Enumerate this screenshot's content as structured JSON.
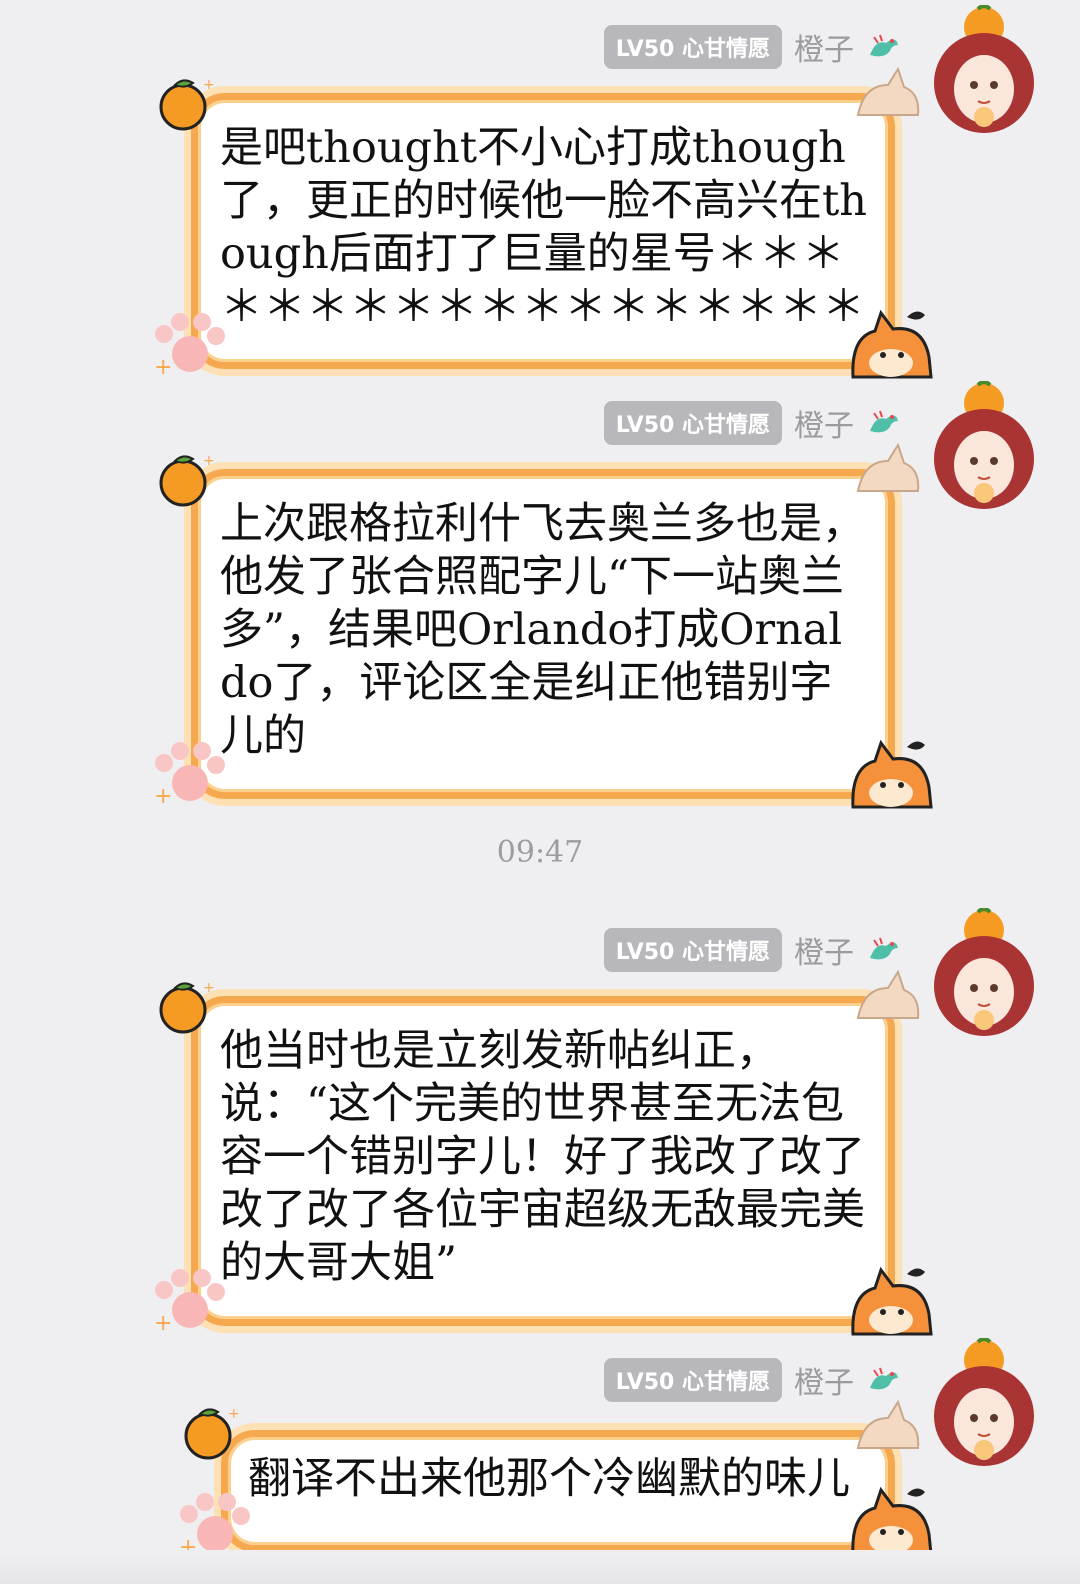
{
  "messages": [
    {
      "badge": "LV50 心甘情愿",
      "name": "橙子",
      "text": "是吧thought不小心打成though了，更正的时候他一脸不高兴在though后面打了巨量的星号＊＊＊＊＊＊＊＊＊＊＊＊＊＊＊＊＊＊"
    },
    {
      "badge": "LV50 心甘情愿",
      "name": "橙子",
      "text": "上次跟格拉利什飞去奥兰多也是，他发了张合照配字儿“下一站奥兰多”，结果吧Orlando打成Ornaldo了，评论区全是纠正他错别字儿的"
    },
    {
      "badge": "LV50 心甘情愿",
      "name": "橙子",
      "text": "他当时也是立刻发新帖纠正，说：“这个完美的世界甚至无法包容一个错别字儿！好了我改了改了改了改了各位宇宙超级无敌最完美的大哥大姐”"
    },
    {
      "badge": "LV50 心甘情愿",
      "name": "橙子",
      "text": "翻译不出来他那个冷幽默的味儿"
    }
  ],
  "timestamp": "09:47",
  "colors": {
    "bubble_border": "#f6a84f",
    "bubble_glow": "#fde1b4",
    "badge_bg": "#b8b8bc",
    "background": "#efeff1"
  },
  "icons": [
    "orange-icon",
    "paw-icon",
    "fox-icon",
    "dragon-icon",
    "avatar-icon"
  ]
}
